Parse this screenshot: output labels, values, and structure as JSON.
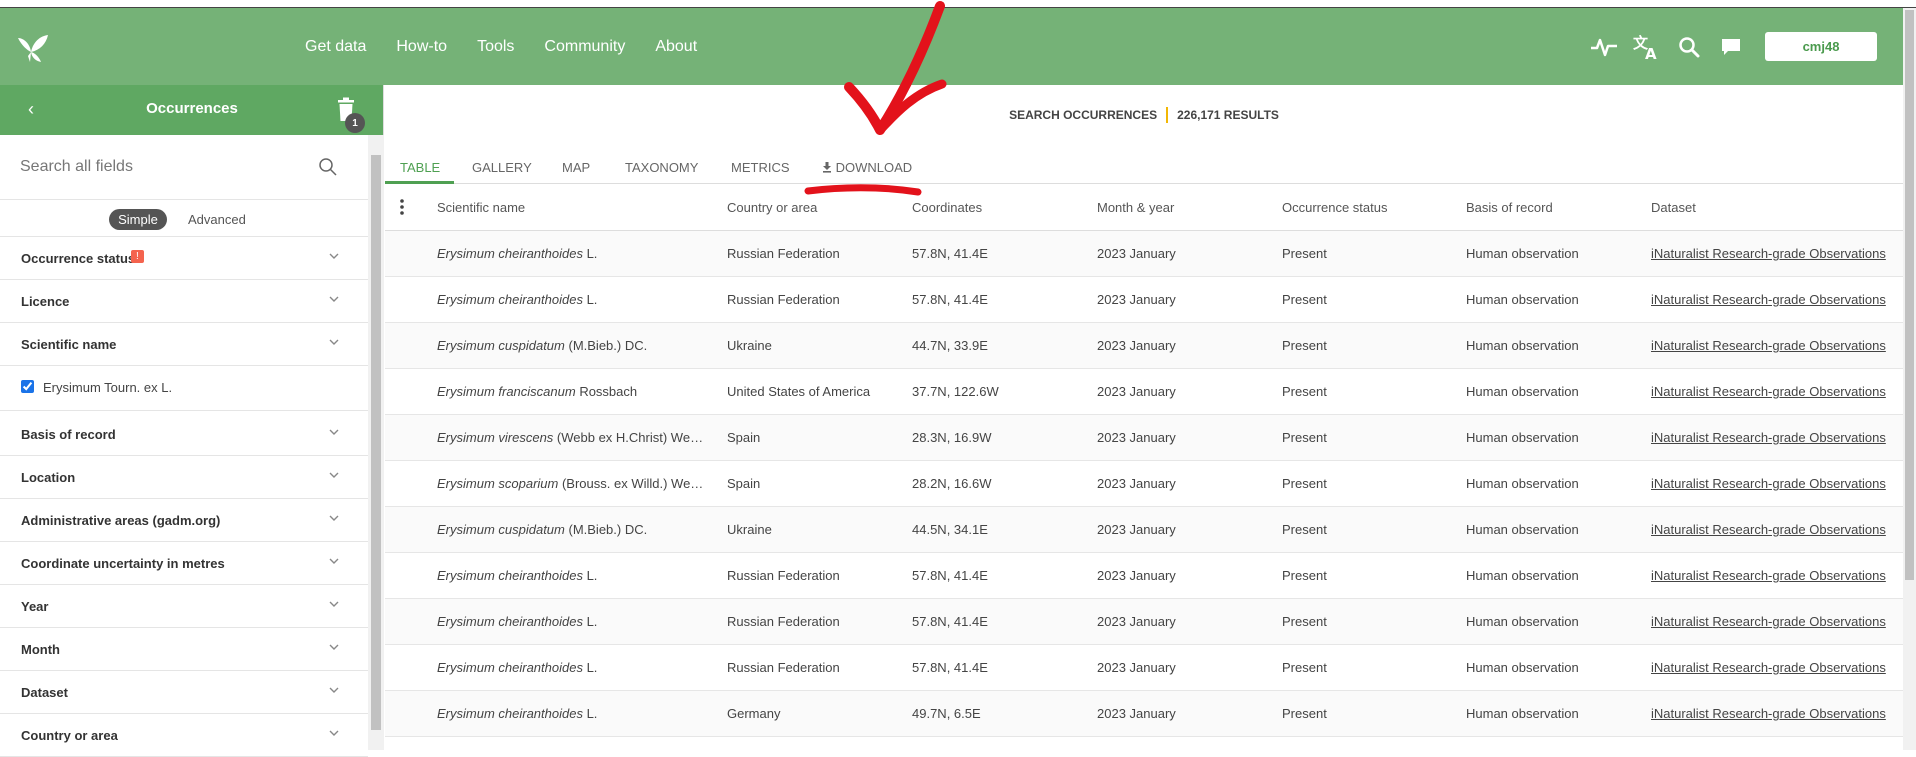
{
  "header": {
    "nav": [
      "Get data",
      "How-to",
      "Tools",
      "Community",
      "About"
    ],
    "user": "cmj48",
    "icons": [
      "activity-icon",
      "translate-icon",
      "search-icon",
      "feedback-icon"
    ]
  },
  "sidebar": {
    "title": "Occurrences",
    "back": "‹",
    "trash_count": "1",
    "search_placeholder": "Search all fields",
    "mode_simple": "Simple",
    "mode_advanced": "Advanced",
    "filters": [
      {
        "label": "Occurrence status",
        "warn": "!"
      },
      {
        "label": "Licence"
      },
      {
        "label": "Scientific name"
      },
      {
        "label": "Basis of record"
      },
      {
        "label": "Location"
      },
      {
        "label": "Administrative areas (gadm.org)"
      },
      {
        "label": "Coordinate uncertainty in metres"
      },
      {
        "label": "Year"
      },
      {
        "label": "Month"
      },
      {
        "label": "Dataset"
      },
      {
        "label": "Country or area"
      }
    ],
    "scientific_checked": "Erysimum Tourn. ex L."
  },
  "main": {
    "title": "SEARCH OCCURRENCES",
    "results": "226,171 RESULTS",
    "tabs": [
      "TABLE",
      "GALLERY",
      "MAP",
      "TAXONOMY",
      "METRICS",
      "DOWNLOAD"
    ],
    "columns": [
      "Scientific name",
      "Country or area",
      "Coordinates",
      "Month & year",
      "Occurrence status",
      "Basis of record",
      "Dataset"
    ],
    "rows": [
      {
        "genus_species": "Erysimum cheiranthoides",
        "author": " L.",
        "country": "Russian Federation",
        "coords": "57.8N, 41.4E",
        "date": "2023 January",
        "status": "Present",
        "basis": "Human observation",
        "dataset": "iNaturalist Research-grade Observations"
      },
      {
        "genus_species": "Erysimum cheiranthoides",
        "author": " L.",
        "country": "Russian Federation",
        "coords": "57.8N, 41.4E",
        "date": "2023 January",
        "status": "Present",
        "basis": "Human observation",
        "dataset": "iNaturalist Research-grade Observations"
      },
      {
        "genus_species": "Erysimum cuspidatum",
        "author": " (M.Bieb.) DC.",
        "country": "Ukraine",
        "coords": "44.7N, 33.9E",
        "date": "2023 January",
        "status": "Present",
        "basis": "Human observation",
        "dataset": "iNaturalist Research-grade Observations"
      },
      {
        "genus_species": "Erysimum franciscanum",
        "author": " Rossbach",
        "country": "United States of America",
        "coords": "37.7N, 122.6W",
        "date": "2023 January",
        "status": "Present",
        "basis": "Human observation",
        "dataset": "iNaturalist Research-grade Observations"
      },
      {
        "genus_species": "Erysimum virescens",
        "author": " (Webb ex H.Christ) Wet…",
        "country": "Spain",
        "coords": "28.3N, 16.9W",
        "date": "2023 January",
        "status": "Present",
        "basis": "Human observation",
        "dataset": "iNaturalist Research-grade Observations"
      },
      {
        "genus_species": "Erysimum scoparium",
        "author": " (Brouss. ex Willd.) We…",
        "country": "Spain",
        "coords": "28.2N, 16.6W",
        "date": "2023 January",
        "status": "Present",
        "basis": "Human observation",
        "dataset": "iNaturalist Research-grade Observations"
      },
      {
        "genus_species": "Erysimum cuspidatum",
        "author": " (M.Bieb.) DC.",
        "country": "Ukraine",
        "coords": "44.5N, 34.1E",
        "date": "2023 January",
        "status": "Present",
        "basis": "Human observation",
        "dataset": "iNaturalist Research-grade Observations"
      },
      {
        "genus_species": "Erysimum cheiranthoides",
        "author": " L.",
        "country": "Russian Federation",
        "coords": "57.8N, 41.4E",
        "date": "2023 January",
        "status": "Present",
        "basis": "Human observation",
        "dataset": "iNaturalist Research-grade Observations"
      },
      {
        "genus_species": "Erysimum cheiranthoides",
        "author": " L.",
        "country": "Russian Federation",
        "coords": "57.8N, 41.4E",
        "date": "2023 January",
        "status": "Present",
        "basis": "Human observation",
        "dataset": "iNaturalist Research-grade Observations"
      },
      {
        "genus_species": "Erysimum cheiranthoides",
        "author": " L.",
        "country": "Russian Federation",
        "coords": "57.8N, 41.4E",
        "date": "2023 January",
        "status": "Present",
        "basis": "Human observation",
        "dataset": "iNaturalist Research-grade Observations"
      },
      {
        "genus_species": "Erysimum cheiranthoides",
        "author": " L.",
        "country": "Germany",
        "coords": "49.7N, 6.5E",
        "date": "2023 January",
        "status": "Present",
        "basis": "Human observation",
        "dataset": "iNaturalist Research-grade Observations"
      }
    ]
  },
  "colors": {
    "header": "#75b277",
    "accent": "#4fa052",
    "annotation": "#e3121b"
  }
}
